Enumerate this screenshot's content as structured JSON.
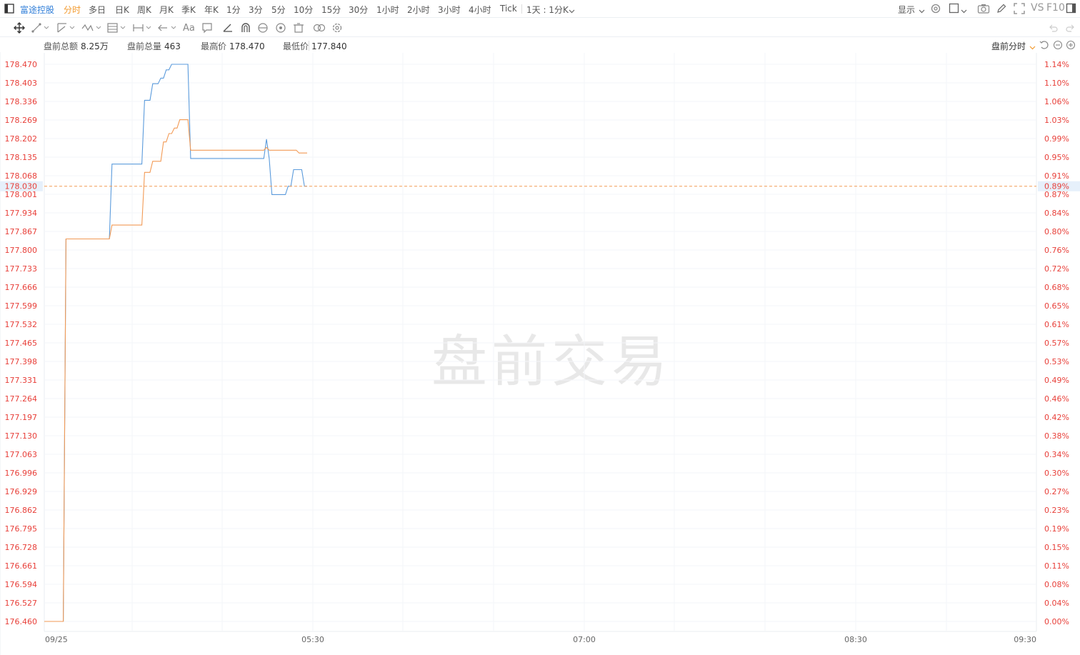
{
  "toolbar": {
    "stock_name": "富途控股",
    "timeframes": [
      "分时",
      "多日",
      "日K",
      "周K",
      "月K",
      "季K",
      "年K",
      "1分",
      "3分",
      "5分",
      "10分",
      "15分",
      "30分",
      "1小时",
      "2小时",
      "3小时",
      "4小时",
      "Tick",
      "1天 : 1分K"
    ],
    "active_timeframe": "分时",
    "display_label": "显示",
    "vs_label": "VS",
    "f10_label": "F10"
  },
  "info": {
    "amount_label": "盘前总额",
    "amount_value": "8.25万",
    "volume_label": "盘前总量",
    "volume_value": "463",
    "high_label": "最高价",
    "high_value": "178.470",
    "low_label": "最低价",
    "low_value": "177.840",
    "mode_label": "盘前分时"
  },
  "watermark": "盘前交易",
  "colors": {
    "price_line": "#5b9bdc",
    "avg_line": "#f29a55",
    "axis_red": "#e8403a",
    "ref_line": "#f29a55",
    "accent": "#2f7ed8"
  },
  "chart_data": {
    "type": "line",
    "y_left_ticks": [
      "178.470",
      "178.403",
      "178.336",
      "178.269",
      "178.202",
      "178.135",
      "178.068",
      "178.001",
      "177.934",
      "177.867",
      "177.800",
      "177.733",
      "177.666",
      "177.599",
      "177.532",
      "177.465",
      "177.398",
      "177.331",
      "177.264",
      "177.197",
      "177.130",
      "177.063",
      "176.996",
      "176.929",
      "176.862",
      "176.795",
      "176.728",
      "176.661",
      "176.594",
      "176.527",
      "176.460"
    ],
    "y_right_ticks": [
      "1.14%",
      "1.10%",
      "1.06%",
      "1.03%",
      "0.99%",
      "0.95%",
      "0.91%",
      "0.87%",
      "0.84%",
      "0.80%",
      "0.76%",
      "0.72%",
      "0.68%",
      "0.65%",
      "0.61%",
      "0.57%",
      "0.53%",
      "0.49%",
      "0.46%",
      "0.42%",
      "0.38%",
      "0.34%",
      "0.30%",
      "0.27%",
      "0.23%",
      "0.19%",
      "0.15%",
      "0.11%",
      "0.08%",
      "0.04%",
      "0.00%"
    ],
    "ylim": [
      176.46,
      178.47
    ],
    "x_ticks": [
      "09/25",
      "05:30",
      "07:00",
      "08:30",
      "09:30"
    ],
    "current_price": "178.030",
    "current_pct": "0.89%",
    "series": [
      {
        "values": [
          176.46,
          176.46,
          176.46,
          176.46,
          176.46,
          176.46,
          176.46,
          176.46,
          177.84,
          177.84,
          177.84,
          177.84,
          177.84,
          177.84,
          177.84,
          177.84,
          177.84,
          177.84,
          177.84,
          177.84,
          177.84,
          177.84,
          177.84,
          177.84,
          177.84,
          178.11,
          178.11,
          178.11,
          178.11,
          178.11,
          178.11,
          178.11,
          178.11,
          178.11,
          178.11,
          178.11,
          178.11,
          178.34,
          178.34,
          178.34,
          178.4,
          178.4,
          178.4,
          178.42,
          178.42,
          178.45,
          178.45,
          178.47,
          178.47,
          178.47,
          178.47,
          178.47,
          178.47,
          178.47,
          178.13,
          178.13,
          178.13,
          178.13,
          178.13,
          178.13,
          178.13,
          178.13,
          178.13,
          178.13,
          178.13,
          178.13,
          178.13,
          178.13,
          178.13,
          178.13,
          178.13,
          178.13,
          178.13,
          178.13,
          178.13,
          178.13,
          178.13,
          178.13,
          178.13,
          178.13,
          178.13,
          178.13,
          178.2,
          178.13,
          178.0,
          178.0,
          178.0,
          178.0,
          178.0,
          178.0,
          178.03,
          178.03,
          178.09,
          178.09,
          178.09,
          178.09,
          178.03,
          178.03
        ]
      },
      {
        "values": [
          176.46,
          176.46,
          176.46,
          176.46,
          176.46,
          176.46,
          176.46,
          176.46,
          177.84,
          177.84,
          177.84,
          177.84,
          177.84,
          177.84,
          177.84,
          177.84,
          177.84,
          177.84,
          177.84,
          177.84,
          177.84,
          177.84,
          177.84,
          177.84,
          177.84,
          177.89,
          177.89,
          177.89,
          177.89,
          177.89,
          177.89,
          177.89,
          177.89,
          177.89,
          177.89,
          177.89,
          177.89,
          178.08,
          178.08,
          178.08,
          178.12,
          178.12,
          178.12,
          178.12,
          178.19,
          178.19,
          178.22,
          178.22,
          178.24,
          178.24,
          178.27,
          178.27,
          178.27,
          178.27,
          178.16,
          178.16,
          178.16,
          178.16,
          178.16,
          178.16,
          178.16,
          178.16,
          178.16,
          178.16,
          178.16,
          178.16,
          178.16,
          178.16,
          178.16,
          178.16,
          178.16,
          178.16,
          178.16,
          178.16,
          178.16,
          178.16,
          178.16,
          178.16,
          178.16,
          178.16,
          178.16,
          178.16,
          178.17,
          178.16,
          178.16,
          178.16,
          178.16,
          178.16,
          178.16,
          178.16,
          178.16,
          178.16,
          178.16,
          178.16,
          178.15,
          178.15,
          178.15,
          178.15
        ]
      }
    ]
  }
}
